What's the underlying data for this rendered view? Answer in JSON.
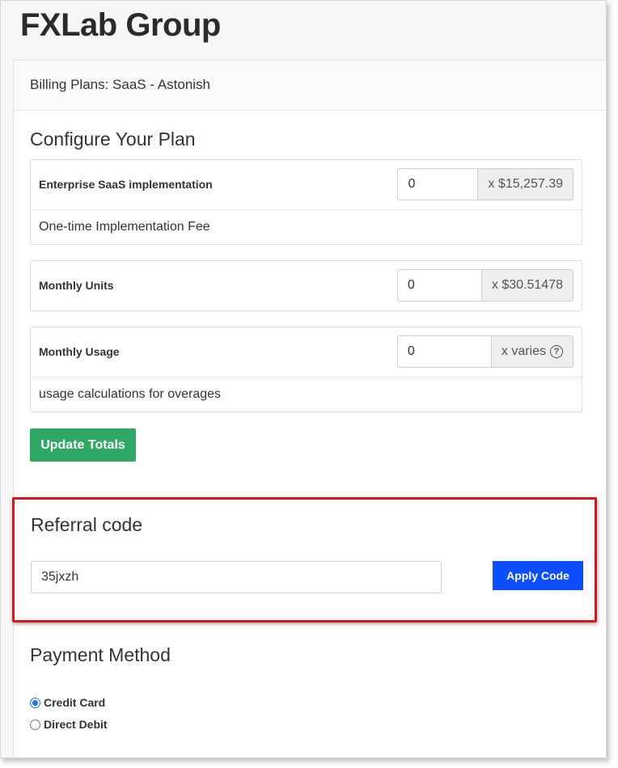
{
  "brand": {
    "title": "FXLab Group"
  },
  "panel": {
    "header": "Billing Plans: SaaS - Astonish"
  },
  "configure": {
    "title": "Configure Your Plan",
    "items": [
      {
        "label": "Enterprise SaaS implementation",
        "quantity": "0",
        "price": "x $15,257.39",
        "description": "One-time Implementation Fee"
      },
      {
        "label": "Monthly Units",
        "quantity": "0",
        "price": "x $30.51478"
      },
      {
        "label": "Monthly Usage",
        "quantity": "0",
        "price": "x varies",
        "help_icon": "question-circle-icon",
        "description": "usage calculations for overages"
      }
    ],
    "update_button": "Update Totals"
  },
  "referral": {
    "title": "Referral code",
    "code_value": "35jxzh",
    "apply_button": "Apply Code",
    "highlight_color": "#d9141b"
  },
  "payment": {
    "title": "Payment Method",
    "options": [
      {
        "label": "Credit Card",
        "selected": true
      },
      {
        "label": "Direct Debit",
        "selected": false
      }
    ]
  },
  "colors": {
    "update_button": "#2fa866",
    "apply_button": "#0b4efd",
    "radio_selected": "#1a73e8"
  }
}
